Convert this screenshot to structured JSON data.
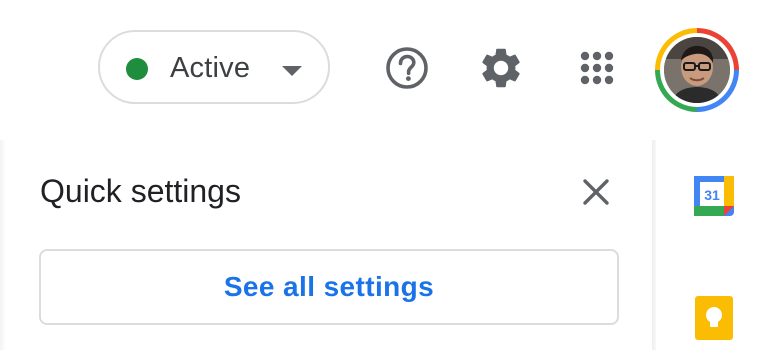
{
  "header": {
    "status": {
      "label": "Active",
      "dot_color": "#1e8e3e"
    },
    "icons": {
      "help": "help-icon",
      "settings": "gear-icon",
      "apps": "apps-grid-icon"
    },
    "avatar": "account-avatar"
  },
  "quick_settings": {
    "title": "Quick settings",
    "close_icon": "close-icon",
    "see_all_label": "See all settings"
  },
  "side_rail": {
    "calendar": {
      "icon": "google-calendar-icon",
      "day": "31"
    },
    "keep": {
      "icon": "google-keep-icon"
    }
  },
  "colors": {
    "accent_blue": "#1a73e8",
    "border": "#dadce0",
    "status_green": "#1e8e3e"
  }
}
